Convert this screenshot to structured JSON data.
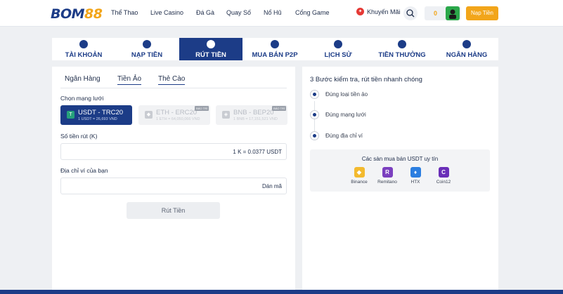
{
  "header": {
    "logo_part1": "BOM",
    "logo_part2": "88",
    "nav": [
      "Thể Thao",
      "Live Casino",
      "Đá Gà",
      "Quay Số",
      "Nổ Hũ",
      "Cổng Game"
    ],
    "promo_label": "Khuyến Mãi",
    "balance": "0",
    "deposit_label": "Nạp Tiền"
  },
  "tabs": [
    "TÀI KHOẢN",
    "NẠP TIỀN",
    "RÚT TIỀN",
    "MUA BÁN P2P",
    "LỊCH SỬ",
    "TIỀN THƯỞNG",
    "NGÂN HÀNG"
  ],
  "active_tab": "RÚT TIỀN",
  "withdraw": {
    "subtabs": [
      "Ngân Hàng",
      "Tiền Ảo",
      "Thẻ Cào"
    ],
    "active_subtab": "Tiền Ảo",
    "network_label": "Chọn mạng lưới",
    "networks": [
      {
        "name": "USDT - TRC20",
        "rate": "1 USDT = 26,693 VND",
        "tag": ""
      },
      {
        "name": "ETH - ERC20",
        "rate": "1 ETH = 64,050,066 VND",
        "tag": "BẢO TRÌ"
      },
      {
        "name": "BNB - BEP20",
        "rate": "1 BNB = 17,151,521 VND",
        "tag": "BẢO TRÌ"
      }
    ],
    "amount_label": "Số tiền rút (K)",
    "amount_rate": "1 K = 0.0377 USDT",
    "address_label": "Địa chỉ ví của bạn",
    "paste_label": "Dán mã",
    "submit_label": "Rút Tiền"
  },
  "guide": {
    "title": "3 Bước kiểm tra, rút tiền nhanh chóng",
    "steps": [
      "Đúng loại tiền ảo",
      "Đúng mạng lưới",
      "Đúng địa chỉ ví"
    ],
    "exchanges_title": "Các sàn mua bán USDT uy tín",
    "exchanges": [
      {
        "name": "Binance",
        "color": "#f3ba2f",
        "glyph": "◆"
      },
      {
        "name": "Remitano",
        "color": "#7b3fbf",
        "glyph": "R"
      },
      {
        "name": "HTX",
        "color": "#2b7ee0",
        "glyph": "♦"
      },
      {
        "name": "Coin12",
        "color": "#6a2fb8",
        "glyph": "C"
      }
    ]
  },
  "colors": {
    "primary": "#1c3c87",
    "accent": "#f2a51a",
    "tether": "#26a17b"
  }
}
